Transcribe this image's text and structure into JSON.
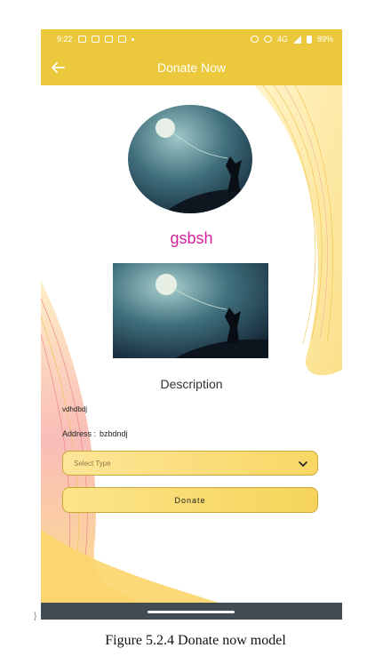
{
  "status_bar": {
    "time": "9:22",
    "network": "4G",
    "battery": "89%"
  },
  "app_bar": {
    "title": "Donate Now",
    "back_icon": "arrow-left-icon"
  },
  "profile": {
    "username": "gsbsh"
  },
  "details": {
    "section_title": "Description",
    "description": "vdhdbdj",
    "address_label": "Address :",
    "address_value": "bzbdndj"
  },
  "form": {
    "select_placeholder": "Select Type",
    "donate_label": "Donate"
  },
  "figure_caption": "Figure   5.2.4 Donate now model",
  "colors": {
    "accent": "#ecc83c",
    "username": "#d4239b",
    "nav_bar": "#434b53"
  }
}
